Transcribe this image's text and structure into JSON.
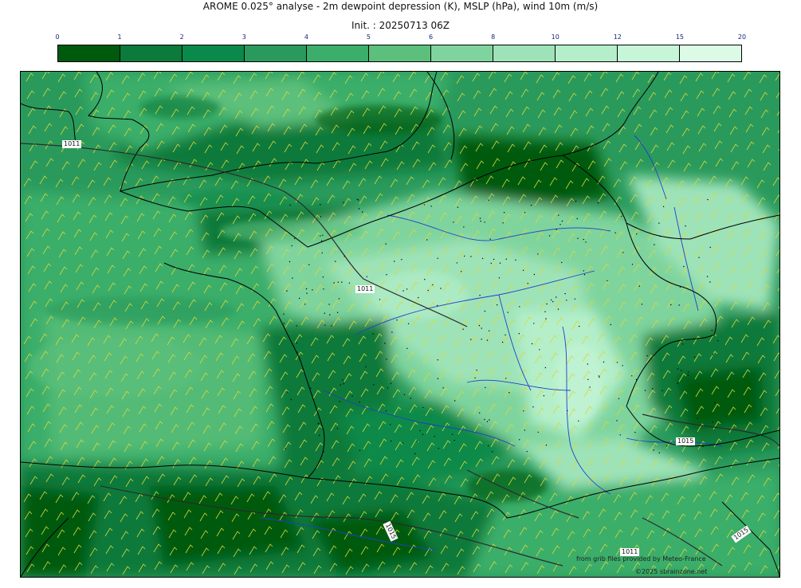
{
  "header": {
    "title": "AROME 0.025° analyse - 2m dewpoint depression (K), MSLP (hPa), wind 10m (m/s)",
    "init": "Init. : 20250713 06Z"
  },
  "colorbar": {
    "ticks": [
      "0",
      "1",
      "2",
      "3",
      "4",
      "5",
      "6",
      "8",
      "10",
      "12",
      "15",
      "20"
    ],
    "colors": [
      "#005a0d",
      "#0c7a3a",
      "#0a8a4a",
      "#2a9a5c",
      "#3aae6a",
      "#5cc07c",
      "#7fd49e",
      "#9ee3b8",
      "#b4efca",
      "#c6f5d8",
      "#dcfbe6"
    ]
  },
  "map": {
    "isobar_labels": [
      "1011",
      "1011",
      "1015",
      "1015",
      "1011",
      "1015"
    ],
    "overlay_colors": {
      "coast": "#000000",
      "rivers": "#1e40c8",
      "isobars": "#2b2b2b",
      "wind": "#d8d83a"
    }
  },
  "credits": {
    "line1": "from grib files provided by Meteo-France",
    "line2": "©2025 sbrainzone.net"
  }
}
